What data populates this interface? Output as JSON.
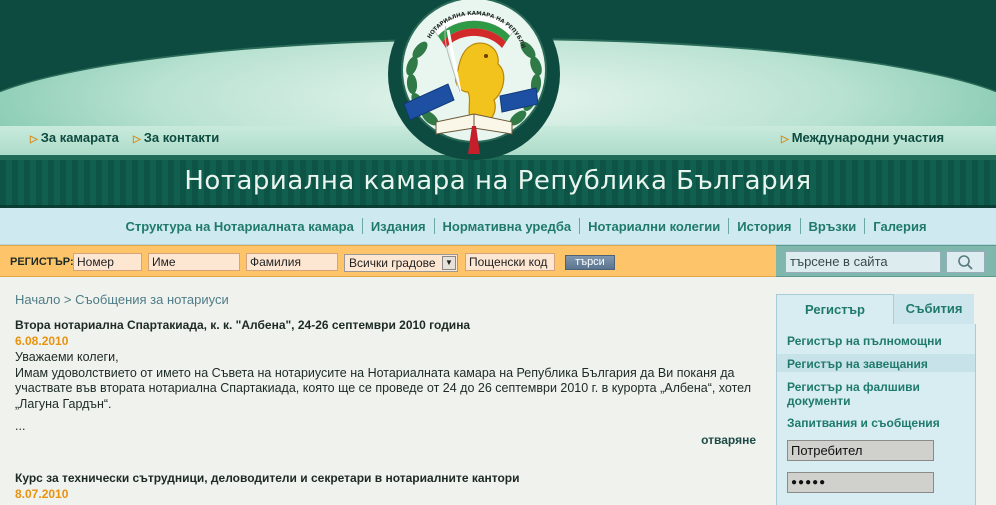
{
  "header": {
    "links_left": [
      {
        "label": "За камарата"
      },
      {
        "label": "За контакти"
      }
    ],
    "link_right": {
      "label": "Международни участия"
    },
    "site_title": "Нотариална камара на Република България"
  },
  "nav": {
    "items": [
      {
        "label": "Структура на Нотариалната камара"
      },
      {
        "label": "Издания"
      },
      {
        "label": "Нормативна уредба"
      },
      {
        "label": "Нотариални колегии"
      },
      {
        "label": "История"
      },
      {
        "label": "Връзки"
      },
      {
        "label": "Галерия"
      }
    ]
  },
  "register": {
    "label": "РЕГИСТЪР:",
    "number_value": "Номер",
    "name_value": "Име",
    "surname_value": "Фамилия",
    "city_selected": "Всички градове",
    "postcode_value": "Пощенски код",
    "search_button": "търси"
  },
  "site_search": {
    "value": "търсене в сайта"
  },
  "breadcrumb": {
    "home": "Начало",
    "separator": " > ",
    "current": "Съобщения за нотариуси"
  },
  "articles": [
    {
      "title": "Втора нотариална Спартакиада, к. к. \"Албена\", 24-26 септември 2010 година",
      "date": "6.08.2010",
      "body_line1": "Уважаеми колеги,",
      "body_line2": "Имам удоволствието от името на Съвета на нотариусите на Нотариалната камара на Република България да Ви поканя да участвате във втората нотариална Спартакиада, която ще се проведе от 24 до 26 септември 2010 г. в курорта „Албена“, хотел „Лагуна Гардън“.",
      "ellipsis": "...",
      "read_more": "отваряне"
    },
    {
      "title": "Курс за технически сътрудници, деловодители и секретари в нотариалните кантори",
      "date": "8.07.2010"
    }
  ],
  "sidebar": {
    "tabs": [
      {
        "label": "Регистър",
        "active": true
      },
      {
        "label": "Събития",
        "active": false
      }
    ],
    "links": [
      {
        "label": "Регистър на пълномощни"
      },
      {
        "label": "Регистър на завещания"
      },
      {
        "label": "Регистър на фалшиви документи"
      },
      {
        "label": "Запитвания и съобщения"
      }
    ],
    "login": {
      "username_value": "Потребител",
      "password_value": "●●●●●"
    }
  },
  "emblem": {
    "ribbon_text": "НОТАРИАЛНА КАМАРА НА РЕПУБЛИКА БЪЛГАРИЯ"
  },
  "colors": {
    "header_dark": "#0d4a3f",
    "nav_text": "#1f7a6c",
    "register_bar": "#fdc46a",
    "date_orange": "#e8920e"
  }
}
